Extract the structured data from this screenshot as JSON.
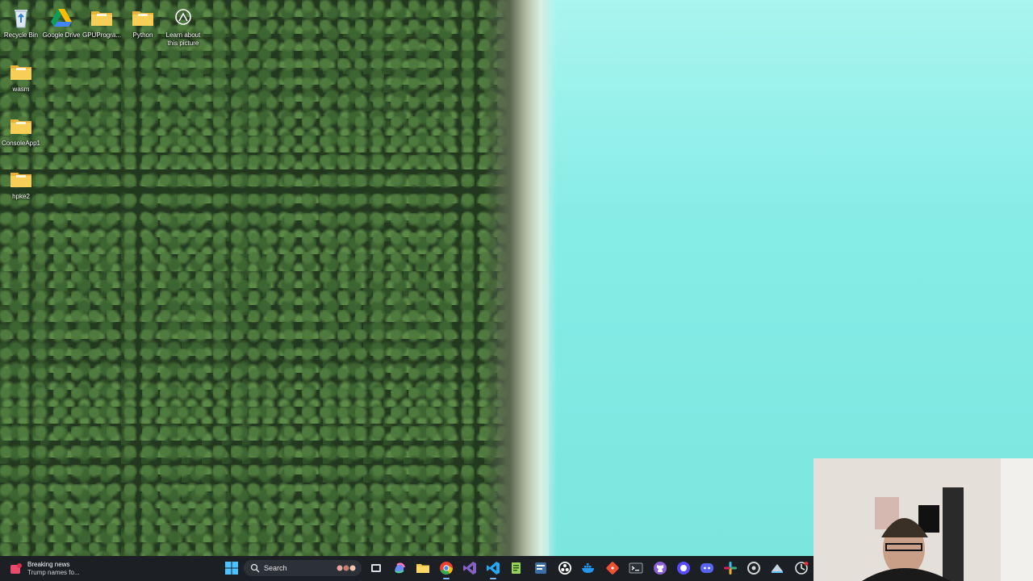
{
  "desktop": {
    "icons": [
      {
        "label": "Recycle Bin",
        "icon": "recycle-bin-icon"
      },
      {
        "label": "Google Drive",
        "icon": "google-drive-icon"
      },
      {
        "label": "GPUProgra...",
        "icon": "folder-icon"
      },
      {
        "label": "Python",
        "icon": "folder-icon"
      },
      {
        "label": "Learn about this picture",
        "icon": "camera-info-icon"
      },
      {
        "label": "wasm",
        "icon": "folder-icon"
      },
      {
        "label": "ConsoleApp1",
        "icon": "folder-icon"
      },
      {
        "label": "hpke2",
        "icon": "folder-icon"
      }
    ]
  },
  "taskbar": {
    "news": {
      "title": "Breaking news",
      "subtitle": "Trump names fo..."
    },
    "search": {
      "placeholder": "Search"
    },
    "apps": [
      "windows-start-icon",
      "task-view-icon",
      "copilot-icon",
      "file-explorer-icon",
      "chrome-icon",
      "visual-studio-icon",
      "vscode-icon",
      "notepad-plus-icon",
      "cmake-gui-icon",
      "obs-icon",
      "docker-icon",
      "git-gui-icon",
      "terminal-icon",
      "github-desktop-icon",
      "signal-icon",
      "discord-icon",
      "slack-icon",
      "app-settings-icon",
      "steam-icon",
      "capture-icon"
    ]
  },
  "colors": {
    "taskbar_bg": "#1c2024",
    "folder_yellow": "#f5c94a",
    "water": "#9ff0ea",
    "forest": "#22391f",
    "accent_active": "#7ab8ff"
  }
}
